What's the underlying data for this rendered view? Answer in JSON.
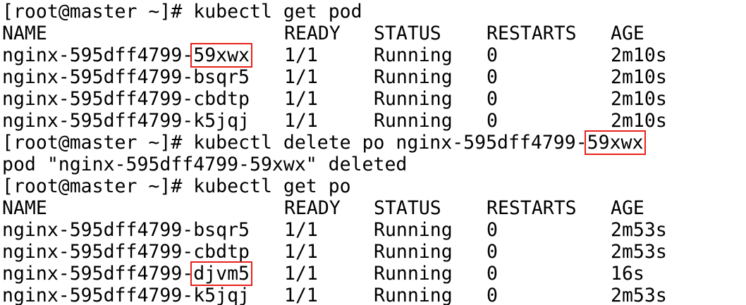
{
  "terminal": {
    "lines": [
      {
        "type": "prompt",
        "prompt": "[root@master ~]#",
        "command_pre": "kubectl get pod",
        "command_hl": ""
      },
      {
        "type": "header",
        "cells": [
          "NAME",
          "READY",
          "STATUS",
          "RESTARTS",
          "AGE"
        ]
      },
      {
        "type": "row",
        "name_pre": "nginx-595dff4799-",
        "name_hl": "59xwx",
        "cells": [
          "1/1",
          "Running",
          "0",
          "2m10s"
        ]
      },
      {
        "type": "row",
        "name_pre": "nginx-595dff4799-bsqr5",
        "name_hl": "",
        "cells": [
          "1/1",
          "Running",
          "0",
          "2m10s"
        ]
      },
      {
        "type": "row",
        "name_pre": "nginx-595dff4799-cbdtp",
        "name_hl": "",
        "cells": [
          "1/1",
          "Running",
          "0",
          "2m10s"
        ]
      },
      {
        "type": "row",
        "name_pre": "nginx-595dff4799-k5jqj",
        "name_hl": "",
        "cells": [
          "1/1",
          "Running",
          "0",
          "2m10s"
        ]
      },
      {
        "type": "prompt",
        "prompt": "[root@master ~]#",
        "command_pre": "kubectl delete po nginx-595dff4799-",
        "command_hl": "59xwx"
      },
      {
        "type": "output",
        "text": "pod \"nginx-595dff4799-59xwx\" deleted"
      },
      {
        "type": "prompt",
        "prompt": "[root@master ~]#",
        "command_pre": "kubectl get po",
        "command_hl": ""
      },
      {
        "type": "header",
        "cells": [
          "NAME",
          "READY",
          "STATUS",
          "RESTARTS",
          "AGE"
        ]
      },
      {
        "type": "row",
        "name_pre": "nginx-595dff4799-bsqr5",
        "name_hl": "",
        "cells": [
          "1/1",
          "Running",
          "0",
          "2m53s"
        ]
      },
      {
        "type": "row",
        "name_pre": "nginx-595dff4799-cbdtp",
        "name_hl": "",
        "cells": [
          "1/1",
          "Running",
          "0",
          "2m53s"
        ]
      },
      {
        "type": "row",
        "name_pre": "nginx-595dff4799-",
        "name_hl": "djvm5",
        "cells": [
          "1/1",
          "Running",
          "0",
          "16s"
        ]
      },
      {
        "type": "row",
        "name_pre": "nginx-595dff4799-k5jqj",
        "name_hl": "",
        "cells": [
          "1/1",
          "Running",
          "0",
          "2m53s"
        ]
      }
    ]
  },
  "colors": {
    "background": "#ffffff",
    "text": "#000000",
    "highlight_box": "#e8201a"
  }
}
